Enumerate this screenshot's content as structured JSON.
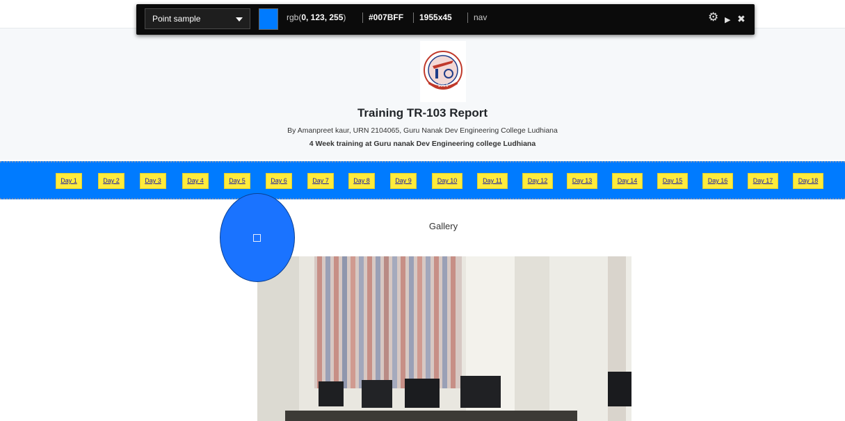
{
  "picker": {
    "mode": "Point sample",
    "swatch_color": "#007BFF",
    "rgb_prefix": "rgb(",
    "rgb_values": "0, 123, 255",
    "rgb_suffix": ")",
    "hex": "#007BFF",
    "size": "1955x45",
    "element": "nav",
    "icons": [
      "gear-icon",
      "play-icon",
      "close-icon"
    ]
  },
  "header": {
    "title": "Training TR-103 Report",
    "byline": "By Amanpreet kaur, URN 2104065, Guru Nanak Dev Engineering College Ludhiana",
    "subtitle": "4 Week training at Guru nanak Dev Engineering college Ludhiana",
    "logo_year": "1956"
  },
  "nav": {
    "background": "#007BFF",
    "button_color": "#FFEB3B",
    "days": [
      "Day 1",
      "Day 2",
      "Day 3",
      "Day 4",
      "Day 5",
      "Day 6",
      "Day 7",
      "Day 8",
      "Day 9",
      "Day 10",
      "Day 11",
      "Day 12",
      "Day 13",
      "Day 14",
      "Day 15",
      "Day 16",
      "Day 17",
      "Day 18"
    ]
  },
  "gallery": {
    "title": "Gallery"
  }
}
